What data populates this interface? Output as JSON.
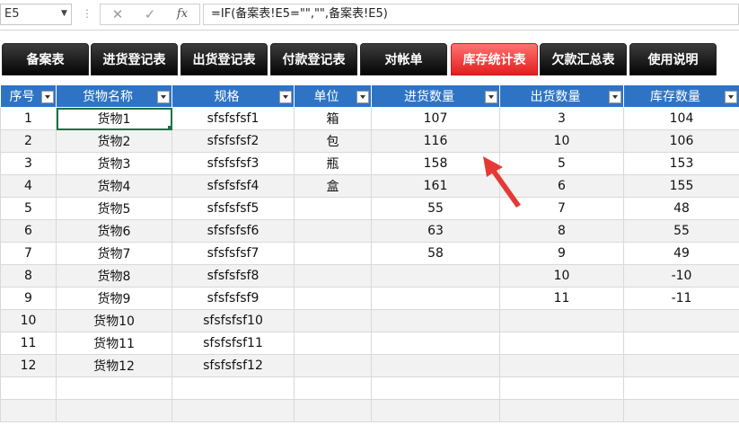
{
  "formula_bar": {
    "name_box": "E5",
    "cancel_glyph": "✕",
    "enter_glyph": "✓",
    "fx_label": "fx",
    "formula": "=IF(备案表!E5=\"\",\"\",备案表!E5)"
  },
  "tabs": [
    {
      "label": "备案表",
      "active": false
    },
    {
      "label": "进货登记表",
      "active": false
    },
    {
      "label": "出货登记表",
      "active": false
    },
    {
      "label": "付款登记表",
      "active": false
    },
    {
      "label": "对帐单",
      "active": false
    },
    {
      "label": "库存统计表",
      "active": true
    },
    {
      "label": "欠款汇总表",
      "active": false
    },
    {
      "label": "使用说明",
      "active": false
    }
  ],
  "table": {
    "headers": [
      "序号",
      "货物名称",
      "规格",
      "单位",
      "进货数量",
      "出货数量",
      "库存数量"
    ],
    "rows": [
      [
        "1",
        "货物1",
        "sfsfsfsf1",
        "箱",
        "107",
        "3",
        "104"
      ],
      [
        "2",
        "货物2",
        "sfsfsfsf2",
        "包",
        "116",
        "10",
        "106"
      ],
      [
        "3",
        "货物3",
        "sfsfsfsf3",
        "瓶",
        "158",
        "5",
        "153"
      ],
      [
        "4",
        "货物4",
        "sfsfsfsf4",
        "盒",
        "161",
        "6",
        "155"
      ],
      [
        "5",
        "货物5",
        "sfsfsfsf5",
        "",
        "55",
        "7",
        "48"
      ],
      [
        "6",
        "货物6",
        "sfsfsfsf6",
        "",
        "63",
        "8",
        "55"
      ],
      [
        "7",
        "货物7",
        "sfsfsfsf7",
        "",
        "58",
        "9",
        "49"
      ],
      [
        "8",
        "货物8",
        "sfsfsfsf8",
        "",
        "",
        "10",
        "-10"
      ],
      [
        "9",
        "货物9",
        "sfsfsfsf9",
        "",
        "",
        "11",
        "-11"
      ],
      [
        "10",
        "货物10",
        "sfsfsfsf10",
        "",
        "",
        "",
        ""
      ],
      [
        "11",
        "货物11",
        "sfsfsfsf11",
        "",
        "",
        "",
        ""
      ],
      [
        "12",
        "货物12",
        "sfsfsfsf12",
        "",
        "",
        "",
        ""
      ],
      [
        "",
        "",
        "",
        "",
        "",
        "",
        ""
      ],
      [
        "",
        "",
        "",
        "",
        "",
        "",
        ""
      ]
    ]
  },
  "colors": {
    "header_blue": "#2f74c4",
    "active_tab_red": "#e21e1e",
    "tab_black": "#050505",
    "annotation_arrow": "#e53935"
  },
  "icons": {
    "annotation": "red-arrow-icon",
    "filter": "filter-dropdown-icon"
  }
}
